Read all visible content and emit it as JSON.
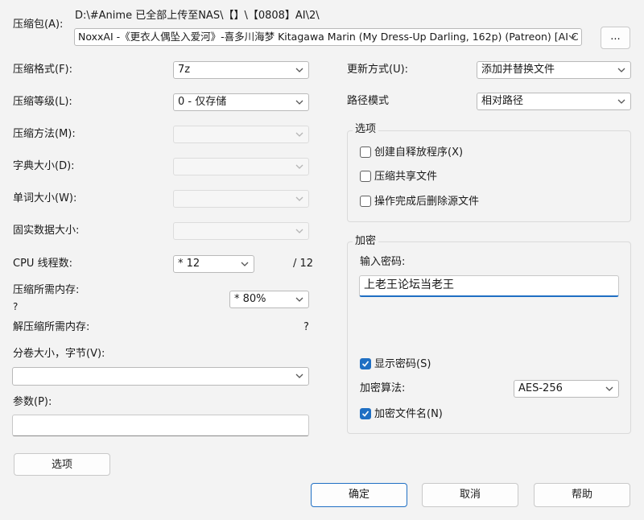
{
  "archive": {
    "label": "压缩包(A):",
    "path": "D:\\#Anime 已全部上传至NAS\\【】\\【0808】AI\\2\\",
    "filename": "NoxxAI -《更衣人偶坠入爱河》-喜多川海梦 Kitagawa Marin (My Dress-Up Darling, 162p) (Patreon) [AI C",
    "browse_label": "..."
  },
  "left": {
    "format": {
      "label": "压缩格式(F):",
      "value": "7z"
    },
    "level": {
      "label": "压缩等级(L):",
      "value": "0 - 仅存储"
    },
    "method": {
      "label": "压缩方法(M):",
      "value": ""
    },
    "dict": {
      "label": "字典大小(D):",
      "value": ""
    },
    "word": {
      "label": "单词大小(W):",
      "value": ""
    },
    "solid": {
      "label": "固实数据大小:",
      "value": ""
    },
    "cpu": {
      "label": "CPU 线程数:",
      "value": "* 12",
      "total": "/ 12"
    },
    "mem_compress": {
      "label": "压缩所需内存:",
      "sub": "?",
      "value": "* 80%"
    },
    "mem_decompress": {
      "label": "解压缩所需内存:",
      "value": "?"
    },
    "volume": {
      "label": "分卷大小，字节(V):",
      "value": ""
    },
    "params": {
      "label": "参数(P):",
      "value": ""
    },
    "options_button": "选项"
  },
  "right": {
    "update": {
      "label": "更新方式(U):",
      "value": "添加并替换文件"
    },
    "pathmode": {
      "label": "路径模式",
      "value": "相对路径"
    },
    "options_group": {
      "title": "选项",
      "sfx": "创建自释放程序(X)",
      "shared": "压缩共享文件",
      "delete": "操作完成后删除源文件"
    },
    "encryption": {
      "title": "加密",
      "password_label": "输入密码:",
      "password_value": "上老王论坛当老王",
      "show_password": "显示密码(S)",
      "algo_label": "加密算法:",
      "algo_value": "AES-256",
      "encrypt_names": "加密文件名(N)"
    }
  },
  "footer": {
    "ok": "确定",
    "cancel": "取消",
    "help": "帮助"
  },
  "checkboxes": {
    "sfx": false,
    "shared": false,
    "delete": false,
    "show_password": true,
    "encrypt_names": true
  },
  "colors": {
    "accent": "#1f6fc3",
    "background": "#f3f3f3"
  }
}
